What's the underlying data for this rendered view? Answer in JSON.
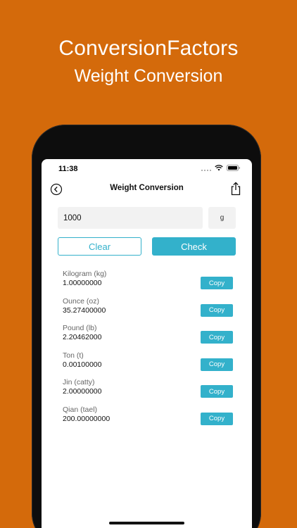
{
  "promo": {
    "title": "ConversionFactors",
    "subtitle": "Weight Conversion"
  },
  "status_bar": {
    "time": "11:38",
    "icons": [
      "signal-icon",
      "wifi-icon",
      "battery-icon"
    ]
  },
  "nav": {
    "title": "Weight Conversion",
    "back_icon": "back-icon",
    "share_icon": "share-icon"
  },
  "input": {
    "value": "1000",
    "unit": "g"
  },
  "buttons": {
    "clear": "Clear",
    "check": "Check"
  },
  "results": [
    {
      "unit": "Kilogram (kg)",
      "value": "1.00000000",
      "copy": "Copy"
    },
    {
      "unit": "Ounce (oz)",
      "value": "35.27400000",
      "copy": "Copy"
    },
    {
      "unit": "Pound (lb)",
      "value": "2.20462000",
      "copy": "Copy"
    },
    {
      "unit": "Ton (t)",
      "value": "0.00100000",
      "copy": "Copy"
    },
    {
      "unit": "Jin (catty)",
      "value": "2.00000000",
      "copy": "Copy"
    },
    {
      "unit": "Qian (tael)",
      "value": "200.00000000",
      "copy": "Copy"
    }
  ],
  "colors": {
    "background": "#d46a0b",
    "accent": "#33b1cb"
  }
}
